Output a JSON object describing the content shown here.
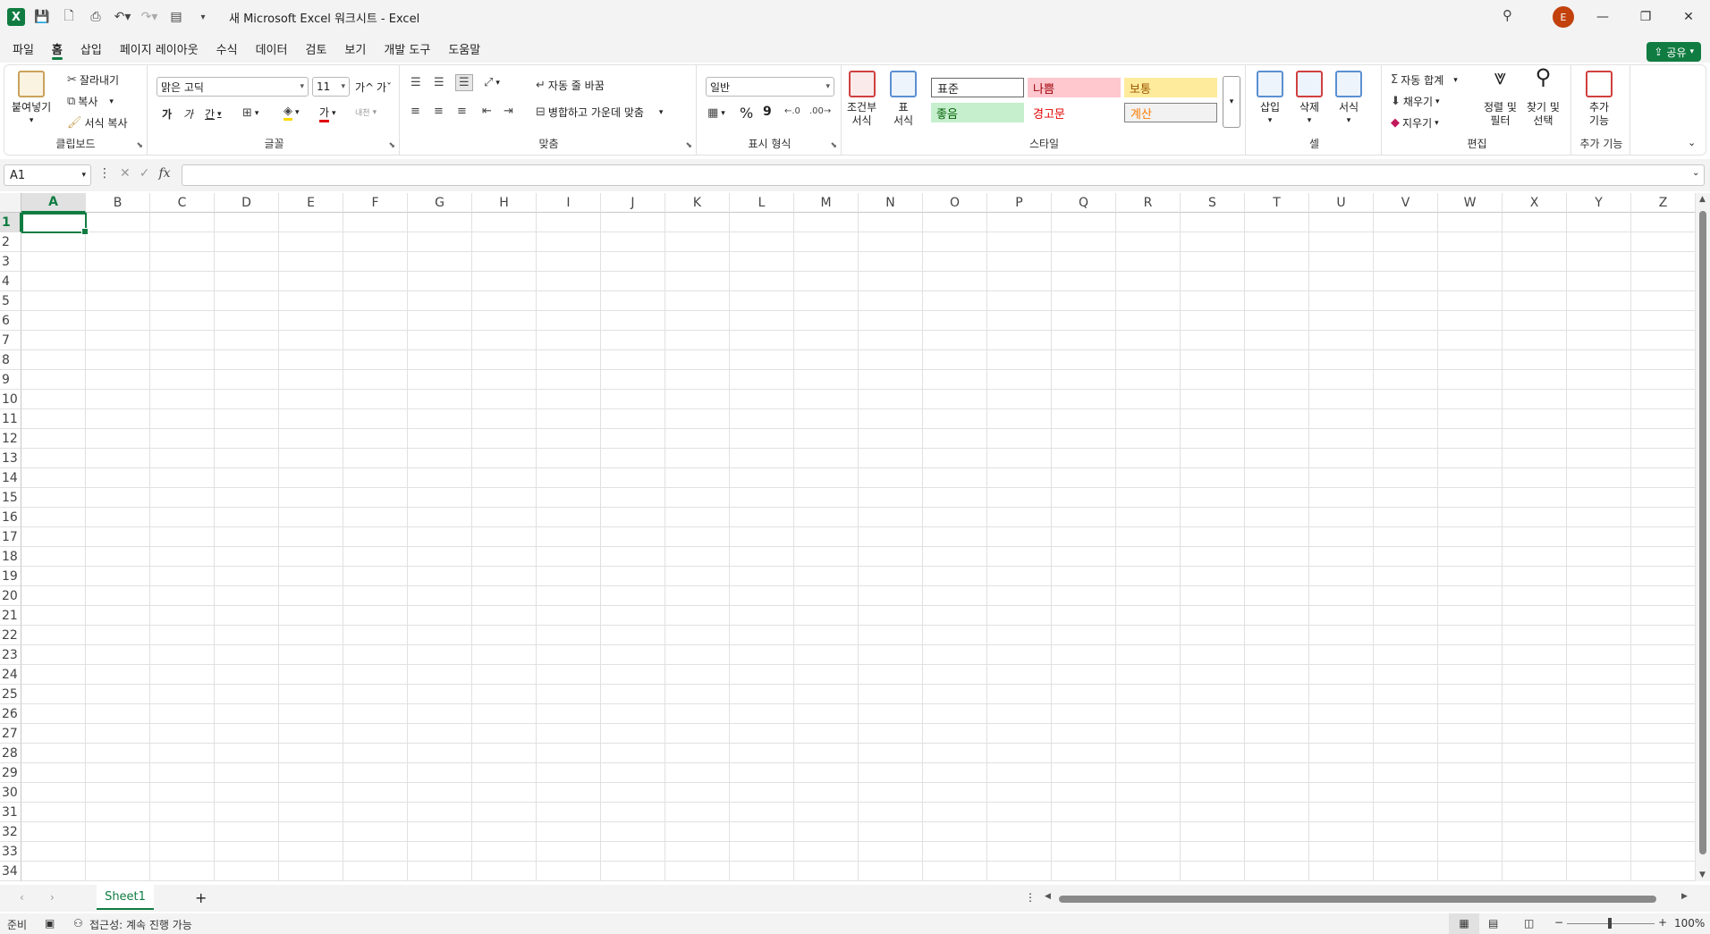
{
  "app": {
    "title": "새 Microsoft Excel 워크시트  -  Excel",
    "avatar_initial": "E",
    "accent": "#107c41"
  },
  "menu": {
    "tabs": [
      "파일",
      "홈",
      "삽입",
      "페이지 레이아웃",
      "수식",
      "데이터",
      "검토",
      "보기",
      "개발 도구",
      "도움말"
    ],
    "active": "홈",
    "share": "공유"
  },
  "ribbon": {
    "clipboard": {
      "paste": "붙여넣기",
      "cut": "잘라내기",
      "copy": "복사",
      "format_painter": "서식 복사",
      "label": "클립보드"
    },
    "font": {
      "name": "맑은 고딕",
      "size": "11",
      "bold": "가",
      "italic": "가",
      "underline": "간",
      "grow": "가^",
      "shrink": "가ˇ",
      "font_color": "가",
      "phonetic": "내천",
      "label": "글꼴"
    },
    "alignment": {
      "wrap": "자동 줄 바꿈",
      "merge": "병합하고 가운데 맞춤",
      "label": "맞춤"
    },
    "number": {
      "format": "일반",
      "percent": "%",
      "comma": "9",
      "label": "표시 형식"
    },
    "styles": {
      "conditional": [
        "조건부",
        "서식"
      ],
      "table": [
        "표",
        "서식"
      ],
      "normal": "표준",
      "bad": "나쁨",
      "neutral": "보통",
      "good": "좋음",
      "warning": "경고문",
      "calculation": "계산",
      "label": "스타일"
    },
    "cells": {
      "insert": "삽입",
      "delete": "삭제",
      "format": "서식",
      "label": "셀"
    },
    "editing": {
      "autosum": "자동 합계",
      "fill": "채우기",
      "clear": "지우기",
      "sort": [
        "정렬 및",
        "필터"
      ],
      "find": [
        "찾기 및",
        "선택"
      ],
      "label": "편집"
    },
    "addins": {
      "btn": [
        "추가",
        "기능"
      ],
      "label": "추가 기능"
    }
  },
  "formula": {
    "namebox": "A1",
    "fx": "fx",
    "value": ""
  },
  "grid": {
    "columns": [
      "A",
      "B",
      "C",
      "D",
      "E",
      "F",
      "G",
      "H",
      "I",
      "J",
      "K",
      "L",
      "M",
      "N",
      "O",
      "P",
      "Q",
      "R",
      "S",
      "T",
      "U",
      "V",
      "W",
      "X",
      "Y",
      "Z"
    ],
    "rows": [
      "1",
      "2",
      "3",
      "4",
      "5",
      "6",
      "7",
      "8",
      "9",
      "10",
      "11",
      "12",
      "13",
      "14",
      "15",
      "16",
      "17",
      "18",
      "19",
      "20",
      "21",
      "22",
      "23",
      "24",
      "25",
      "26",
      "27",
      "28",
      "29",
      "30",
      "31",
      "32",
      "33",
      "34"
    ]
  },
  "sheets": {
    "tabs": [
      "Sheet1"
    ],
    "add": "+"
  },
  "status": {
    "ready": "준비",
    "accessibility": "접근성: 계속 진행 가능",
    "zoom": "100%"
  }
}
